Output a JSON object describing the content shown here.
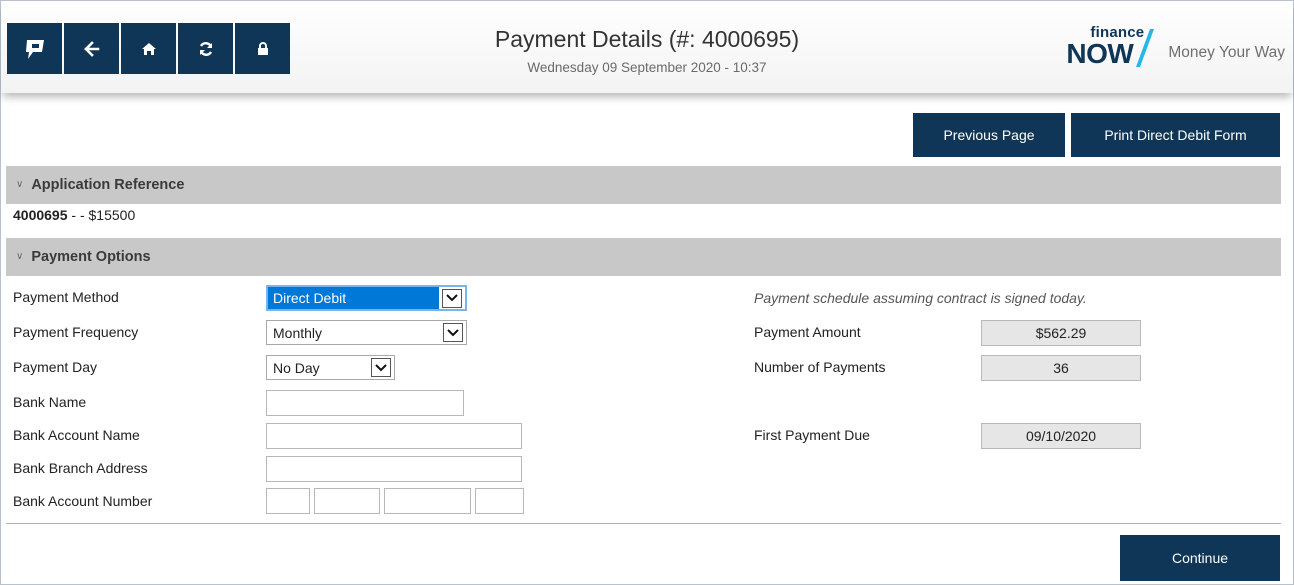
{
  "header": {
    "title": "Payment Details (#: 4000695)",
    "date": "Wednesday 09 September 2020 - 10:37",
    "brand_small": "finance",
    "brand_big": "NOW",
    "tagline": "Money Your Way"
  },
  "nav": {
    "icons": [
      "app-logo-icon",
      "back-arrow-icon",
      "home-icon",
      "refresh-icon",
      "lock-icon"
    ]
  },
  "actions": {
    "previous_page": "Previous Page",
    "print_dd_form": "Print Direct Debit Form",
    "continue": "Continue"
  },
  "application_reference": {
    "heading": "Application Reference",
    "id": "4000695",
    "rest": " - - $15500"
  },
  "payment_options": {
    "heading": "Payment Options",
    "labels": {
      "method": "Payment Method",
      "frequency": "Payment Frequency",
      "day": "Payment Day",
      "bank_name": "Bank Name",
      "bank_account_name": "Bank Account Name",
      "bank_branch_address": "Bank Branch Address",
      "bank_account_number": "Bank Account Number"
    },
    "values": {
      "method": "Direct Debit",
      "frequency": "Monthly",
      "day": "No Day",
      "bank_name": "",
      "bank_account_name": "",
      "bank_branch_address": "",
      "bank_account_number": [
        "",
        "",
        "",
        ""
      ]
    },
    "schedule": {
      "note": "Payment schedule assuming contract is signed today.",
      "amount_label": "Payment Amount",
      "amount": "$562.29",
      "count_label": "Number of Payments",
      "count": "36",
      "first_due_label": "First Payment Due",
      "first_due": "09/10/2020"
    }
  },
  "colors": {
    "primary": "#0f3657",
    "section_bar": "#c8c8c8",
    "select_highlight": "#0078d7"
  }
}
